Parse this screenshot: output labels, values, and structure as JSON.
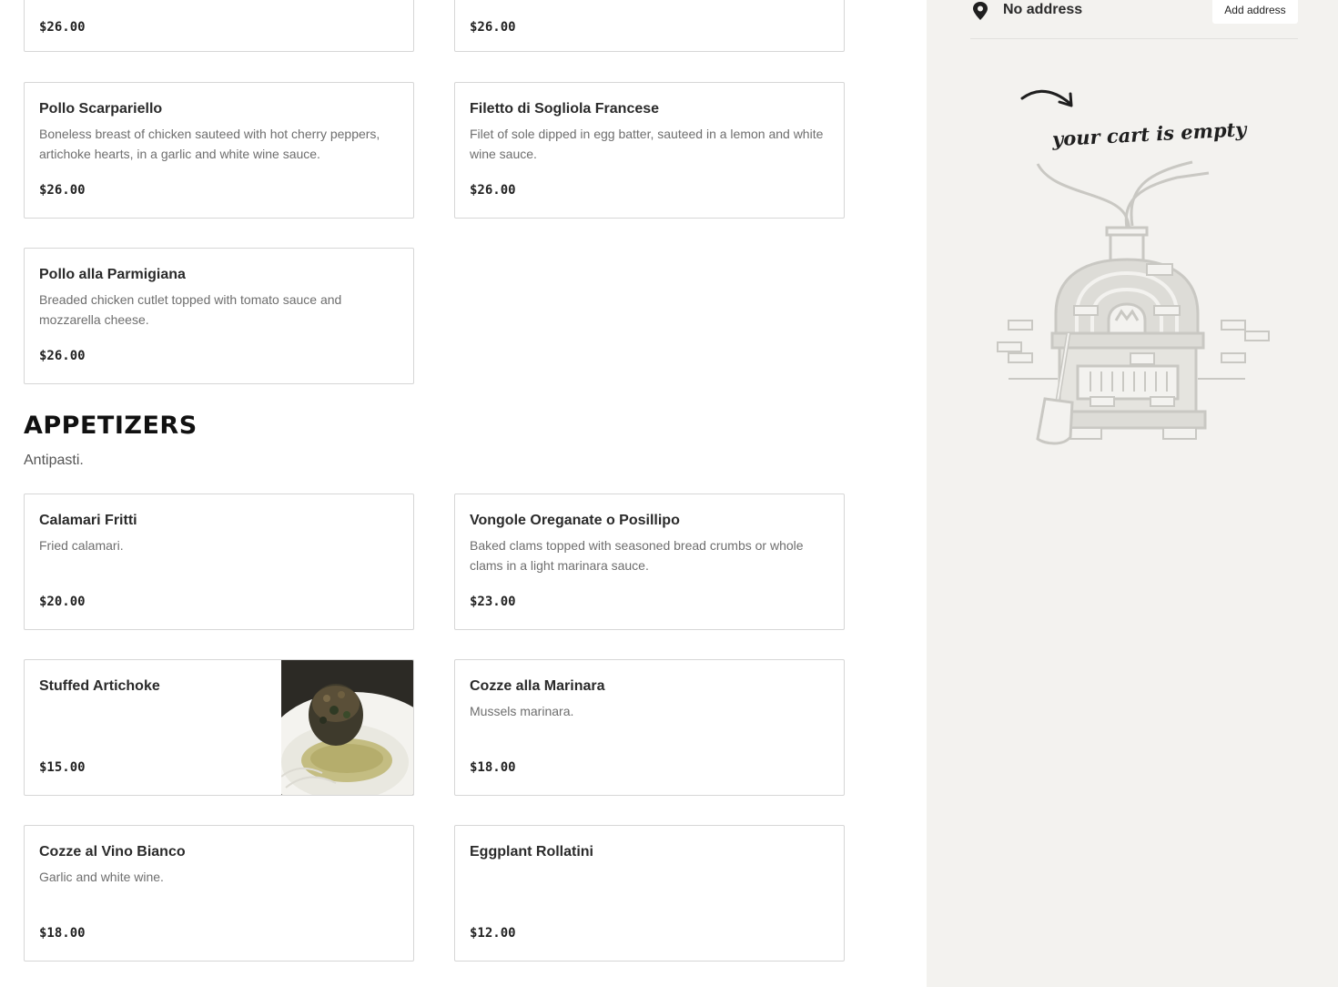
{
  "menu": {
    "top_items": [
      {
        "price": "$26.00"
      },
      {
        "price": "$26.00"
      }
    ],
    "items": [
      {
        "name": "Pollo Scarpariello",
        "description": "Boneless breast of chicken sauteed with hot cherry peppers, artichoke hearts, in a garlic and white wine sauce.",
        "price": "$26.00"
      },
      {
        "name": "Filetto di Sogliola Francese",
        "description": "Filet of sole dipped in egg batter, sauteed in a lemon and white wine sauce.",
        "price": "$26.00"
      },
      {
        "name": "Pollo alla Parmigiana",
        "description": "Breaded chicken cutlet topped with tomato sauce and mozzarella cheese.",
        "price": "$26.00"
      }
    ],
    "section": {
      "title": "APPETIZERS",
      "subtitle": "Antipasti."
    },
    "appetizers": [
      {
        "name": "Calamari Fritti",
        "description": "Fried calamari.",
        "price": "$20.00"
      },
      {
        "name": "Vongole Oreganate o Posillipo",
        "description": "Baked clams topped with seasoned bread crumbs or whole clams in a light marinara sauce.",
        "price": "$23.00"
      },
      {
        "name": "Stuffed Artichoke",
        "description": "",
        "price": "$15.00",
        "image": "stuffed-artichoke-photo"
      },
      {
        "name": "Cozze alla Marinara",
        "description": "Mussels marinara.",
        "price": "$18.00"
      },
      {
        "name": "Cozze al Vino Bianco",
        "description": "Garlic and white wine.",
        "price": "$18.00"
      },
      {
        "name": "Eggplant Rollatini",
        "description": "",
        "price": "$12.00"
      }
    ]
  },
  "cart": {
    "address": "No address",
    "add_address_label": "Add address",
    "empty_message": "your cart is empty",
    "pin_icon": "location-pin-icon",
    "illustration": "pizza-oven-illustration"
  },
  "colors": {
    "sidebar_bg": "#f3f2ef",
    "card_border": "#d6d6d6",
    "text_muted": "#6e6e6e"
  }
}
